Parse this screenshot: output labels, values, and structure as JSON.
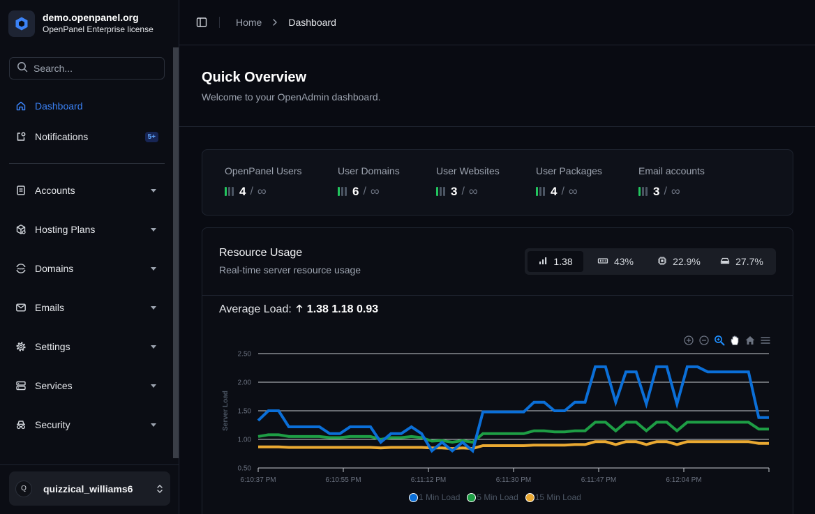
{
  "brand": {
    "title": "demo.openpanel.org",
    "subtitle": "OpenPanel Enterprise license"
  },
  "search": {
    "placeholder": "Search..."
  },
  "sidebar": {
    "top_items": [
      {
        "label": "Dashboard",
        "icon": "home-icon",
        "active": true
      },
      {
        "label": "Notifications",
        "icon": "bell-icon",
        "badge": "5+"
      }
    ],
    "items": [
      {
        "label": "Accounts",
        "icon": "user-card-icon"
      },
      {
        "label": "Hosting Plans",
        "icon": "package-icon"
      },
      {
        "label": "Domains",
        "icon": "globe-www-icon"
      },
      {
        "label": "Emails",
        "icon": "mail-icon"
      },
      {
        "label": "Settings",
        "icon": "gear-icon"
      },
      {
        "label": "Services",
        "icon": "server-icon"
      },
      {
        "label": "Security",
        "icon": "incognito-icon"
      }
    ]
  },
  "user": {
    "initial": "Q",
    "name": "quizzical_williams6"
  },
  "breadcrumb": {
    "home": "Home",
    "current": "Dashboard"
  },
  "page": {
    "title": "Quick Overview",
    "subtitle": "Welcome to your OpenAdmin dashboard."
  },
  "stats": [
    {
      "label": "OpenPanel Users",
      "value": "4",
      "limit": "∞"
    },
    {
      "label": "User Domains",
      "value": "6",
      "limit": "∞"
    },
    {
      "label": "User Websites",
      "value": "3",
      "limit": "∞"
    },
    {
      "label": "User Packages",
      "value": "4",
      "limit": "∞"
    },
    {
      "label": "Email accounts",
      "value": "3",
      "limit": "∞"
    }
  ],
  "resource": {
    "title": "Resource Usage",
    "subtitle": "Real-time server resource usage",
    "tabs": [
      {
        "label": "1.38",
        "icon": "load-bars-icon",
        "active": true
      },
      {
        "label": "43%",
        "icon": "memory-icon"
      },
      {
        "label": "22.9%",
        "icon": "cpu-icon"
      },
      {
        "label": "27.7%",
        "icon": "disk-icon"
      }
    ],
    "avg_label": "Average Load:",
    "avg_values": "1.38 1.18 0.93"
  },
  "colors": {
    "accent": "#3b82f6",
    "series_1": "#0b6fd8",
    "series_5": "#1e9e45",
    "series_15": "#eaa932",
    "stat_bar_on": "#22c55e"
  },
  "chart_data": {
    "type": "line",
    "ylabel": "Server Load",
    "ylim": [
      0.5,
      2.5
    ],
    "y_ticks": [
      "2.50",
      "2.00",
      "1.50",
      "1.00",
      "0.50"
    ],
    "x_tick_labels": [
      "6:10:37 PM",
      "6:10:55 PM",
      "6:11:12 PM",
      "6:11:30 PM",
      "6:11:47 PM",
      "6:12:04 PM"
    ],
    "grid": true,
    "legend_position": "bottom",
    "series": [
      {
        "name": "1 Min Load",
        "values": [
          1.33,
          1.5,
          1.5,
          1.22,
          1.22,
          1.22,
          1.22,
          1.1,
          1.1,
          1.22,
          1.22,
          1.22,
          0.95,
          1.1,
          1.1,
          1.22,
          1.1,
          0.8,
          0.95,
          0.8,
          0.95,
          0.8,
          1.48,
          1.48,
          1.48,
          1.48,
          1.48,
          1.65,
          1.65,
          1.5,
          1.5,
          1.65,
          1.65,
          2.27,
          2.27,
          1.65,
          2.18,
          2.18,
          1.62,
          2.27,
          2.27,
          1.62,
          2.27,
          2.27,
          2.18,
          2.18,
          2.18,
          2.18,
          2.18,
          1.38,
          1.38
        ]
      },
      {
        "name": "5 Min Load",
        "values": [
          1.05,
          1.08,
          1.08,
          1.05,
          1.05,
          1.05,
          1.05,
          1.03,
          1.03,
          1.05,
          1.05,
          1.05,
          1.0,
          1.03,
          1.03,
          1.05,
          1.03,
          0.97,
          0.98,
          0.95,
          0.98,
          0.95,
          1.1,
          1.1,
          1.1,
          1.1,
          1.1,
          1.15,
          1.15,
          1.13,
          1.13,
          1.15,
          1.15,
          1.3,
          1.3,
          1.15,
          1.3,
          1.3,
          1.15,
          1.3,
          1.3,
          1.15,
          1.3,
          1.3,
          1.3,
          1.3,
          1.3,
          1.3,
          1.3,
          1.18,
          1.18
        ]
      },
      {
        "name": "15 Min Load",
        "values": [
          0.87,
          0.87,
          0.87,
          0.86,
          0.86,
          0.86,
          0.86,
          0.86,
          0.86,
          0.86,
          0.86,
          0.86,
          0.85,
          0.86,
          0.86,
          0.86,
          0.86,
          0.85,
          0.85,
          0.84,
          0.85,
          0.84,
          0.89,
          0.89,
          0.89,
          0.89,
          0.89,
          0.9,
          0.9,
          0.9,
          0.9,
          0.91,
          0.91,
          0.96,
          0.96,
          0.91,
          0.96,
          0.96,
          0.91,
          0.96,
          0.96,
          0.91,
          0.96,
          0.96,
          0.96,
          0.96,
          0.96,
          0.96,
          0.96,
          0.93,
          0.93
        ]
      }
    ]
  }
}
